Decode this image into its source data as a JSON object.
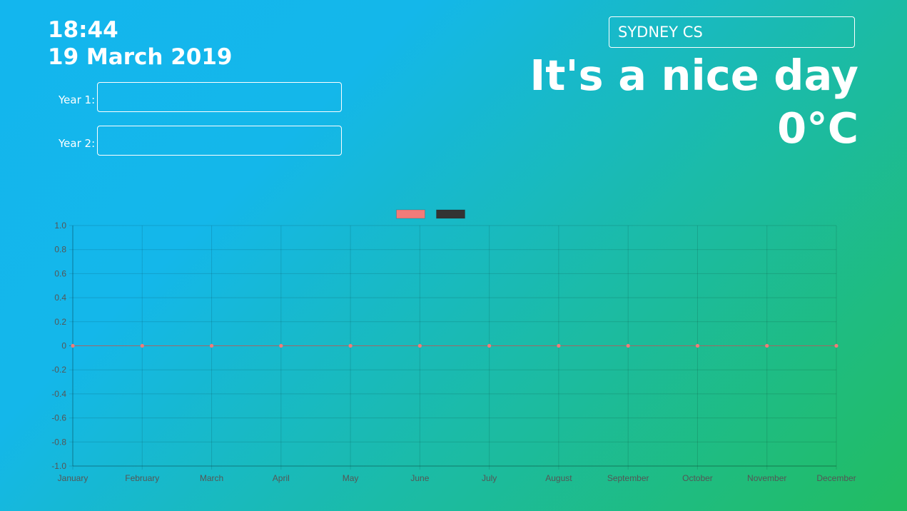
{
  "clock": {
    "time": "18:44",
    "date": "19 March 2019"
  },
  "years": [
    {
      "label": "Year 1:",
      "value": ""
    },
    {
      "label": "Year 2:",
      "value": ""
    }
  ],
  "location": {
    "value": "SYDNEY CS"
  },
  "weather": {
    "description": "It's a nice day",
    "temperature": "0°C"
  },
  "chart_data": {
    "type": "line",
    "categories": [
      "January",
      "February",
      "March",
      "April",
      "May",
      "June",
      "July",
      "August",
      "September",
      "October",
      "November",
      "December"
    ],
    "series": [
      {
        "values": [
          0,
          0,
          0,
          0,
          0,
          0,
          0,
          0,
          0,
          0,
          0,
          0
        ],
        "color": "#f27b79"
      },
      {
        "values": [
          0,
          0,
          0,
          0,
          0,
          0,
          0,
          0,
          0,
          0,
          0,
          0
        ],
        "color": "#333333"
      }
    ],
    "yticks": [
      "1.0",
      "0.8",
      "0.6",
      "0.4",
      "0.2",
      "0",
      "-0.2",
      "-0.4",
      "-0.6",
      "-0.8",
      "-1.0"
    ],
    "ylim": [
      -1,
      1
    ],
    "grid": true,
    "legend": "top-center"
  }
}
